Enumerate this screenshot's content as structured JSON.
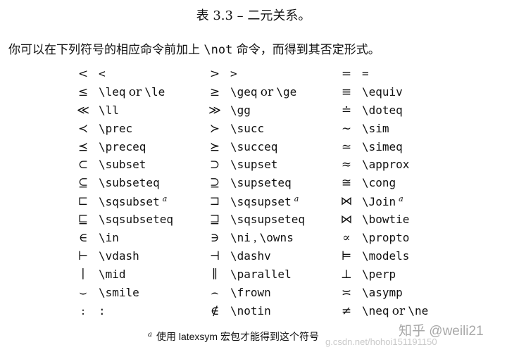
{
  "caption": "表 3.3 – 二元关系。",
  "intro": {
    "before": "你可以在下列符号的相应命令前加上 ",
    "command": "\\not",
    "after": " 命令，而得到其否定形式。"
  },
  "connector": "or",
  "note_marker": "a",
  "rows": [
    [
      {
        "sym": "<",
        "cmd": "<"
      },
      {
        "sym": ">",
        "cmd": ">"
      },
      {
        "sym": "=",
        "cmd": "="
      }
    ],
    [
      {
        "sym": "≤",
        "cmd": "\\leq",
        "alt": "\\le"
      },
      {
        "sym": "≥",
        "cmd": "\\geq",
        "alt": "\\ge"
      },
      {
        "sym": "≡",
        "cmd": "\\equiv"
      }
    ],
    [
      {
        "sym": "≪",
        "cmd": "\\ll"
      },
      {
        "sym": "≫",
        "cmd": "\\gg"
      },
      {
        "sym": "≐",
        "cmd": "\\doteq"
      }
    ],
    [
      {
        "sym": "≺",
        "cmd": "\\prec"
      },
      {
        "sym": "≻",
        "cmd": "\\succ"
      },
      {
        "sym": "∼",
        "cmd": "\\sim"
      }
    ],
    [
      {
        "sym": "⪯",
        "cmd": "\\preceq"
      },
      {
        "sym": "⪰",
        "cmd": "\\succeq"
      },
      {
        "sym": "≃",
        "cmd": "\\simeq"
      }
    ],
    [
      {
        "sym": "⊂",
        "cmd": "\\subset"
      },
      {
        "sym": "⊃",
        "cmd": "\\supset"
      },
      {
        "sym": "≈",
        "cmd": "\\approx"
      }
    ],
    [
      {
        "sym": "⊆",
        "cmd": "\\subseteq"
      },
      {
        "sym": "⊇",
        "cmd": "\\supseteq"
      },
      {
        "sym": "≅",
        "cmd": "\\cong"
      }
    ],
    [
      {
        "sym": "⊏",
        "cmd": "\\sqsubset",
        "note": true
      },
      {
        "sym": "⊐",
        "cmd": "\\sqsupset",
        "note": true
      },
      {
        "sym": "⋈",
        "cmd": "\\Join",
        "note": true
      }
    ],
    [
      {
        "sym": "⊑",
        "cmd": "\\sqsubseteq"
      },
      {
        "sym": "⊒",
        "cmd": "\\sqsupseteq"
      },
      {
        "sym": "⋈",
        "cmd": "\\bowtie"
      }
    ],
    [
      {
        "sym": "∈",
        "cmd": "\\in"
      },
      {
        "sym": "∋",
        "cmd": "\\ni",
        "alt_comma": "\\owns"
      },
      {
        "sym": "∝",
        "cmd": "\\propto"
      }
    ],
    [
      {
        "sym": "⊢",
        "cmd": "\\vdash"
      },
      {
        "sym": "⊣",
        "cmd": "\\dashv"
      },
      {
        "sym": "⊨",
        "cmd": "\\models"
      }
    ],
    [
      {
        "sym": "∣",
        "cmd": "\\mid"
      },
      {
        "sym": "∥",
        "cmd": "\\parallel"
      },
      {
        "sym": "⊥",
        "cmd": "\\perp"
      }
    ],
    [
      {
        "sym": "⌣",
        "cmd": "\\smile"
      },
      {
        "sym": "⌢",
        "cmd": "\\frown"
      },
      {
        "sym": "≍",
        "cmd": "\\asymp"
      }
    ],
    [
      {
        "sym": ":",
        "cmd": ":"
      },
      {
        "sym": "∉",
        "cmd": "\\notin"
      },
      {
        "sym": "≠",
        "cmd": "\\neq",
        "alt": "\\ne"
      }
    ]
  ],
  "footnote": {
    "marker": "a",
    "text": "使用 latexsym 宏包才能得到这个符号"
  },
  "watermark": {
    "url": "g.csdn.net/hohoi151191150",
    "brand": "知乎 @weili21"
  }
}
